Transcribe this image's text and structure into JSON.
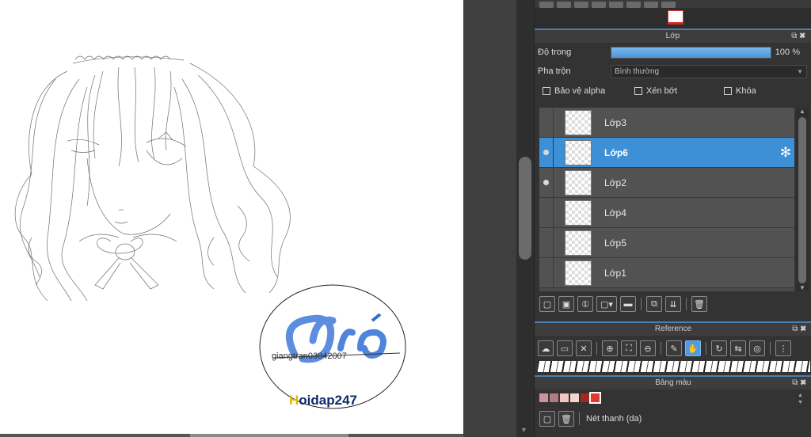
{
  "canvas": {
    "watermark_script": "Gió",
    "watermark_signature": "giangtran03042007",
    "watermark_brand": "Hoidap247"
  },
  "layers_panel": {
    "title": "Lớp",
    "opacity_label": "Độ trong",
    "opacity_value": "100 %",
    "opacity_fraction": 1.0,
    "blend_label": "Pha trộn",
    "blend_value": "Bình thường",
    "protect_alpha": "Bảo vệ alpha",
    "clipping": "Xén bớt",
    "lock": "Khóa",
    "layers": [
      {
        "name": "Lớp3",
        "visible": false,
        "selected": false
      },
      {
        "name": "Lớp6",
        "visible": true,
        "selected": true
      },
      {
        "name": "Lớp2",
        "visible": true,
        "selected": false
      },
      {
        "name": "Lớp4",
        "visible": false,
        "selected": false
      },
      {
        "name": "Lớp5",
        "visible": false,
        "selected": false
      },
      {
        "name": "Lớp1",
        "visible": false,
        "selected": false
      }
    ]
  },
  "reference_panel": {
    "title": "Reference"
  },
  "palette_panel": {
    "title": "Bảng màu",
    "colors": [
      "#c9959a",
      "#b07a80",
      "#f2c6c6",
      "#f5d5cf",
      "#9e2a22",
      "#e03a2e"
    ],
    "brush_name": "Nét thanh (da)"
  },
  "accent_color": "#3d8fd6"
}
